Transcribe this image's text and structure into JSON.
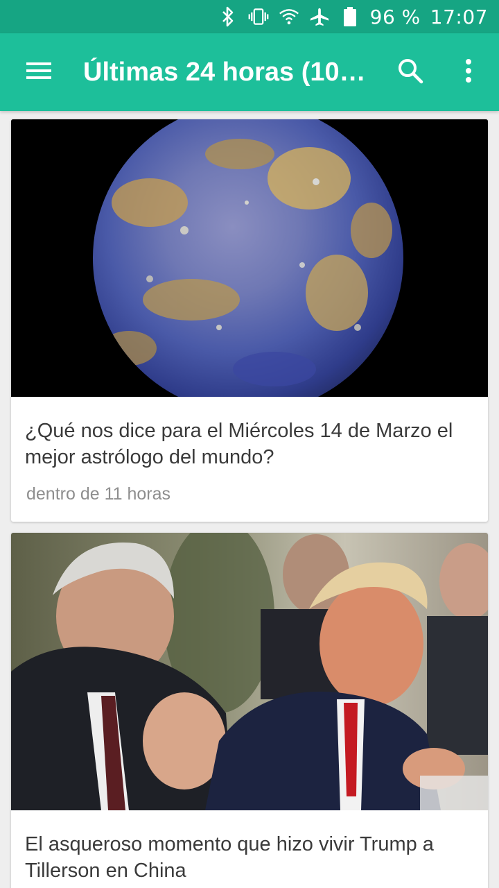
{
  "status_bar": {
    "battery": "96 %",
    "time": "17:07",
    "icons": [
      "bluetooth-icon",
      "vibrate-icon",
      "wifi-icon",
      "airplane-icon",
      "battery-icon"
    ]
  },
  "app_bar": {
    "title": "Últimas 24 horas (10…",
    "icons": [
      "menu-icon",
      "search-icon",
      "more-vert-icon"
    ]
  },
  "articles": [
    {
      "headline": "¿Qué nos dice para el Miércoles 14 de Marzo el mejor astrólogo del mundo?",
      "time": "dentro de 11 horas",
      "image": "planet-mercury-photo"
    },
    {
      "headline": "El asqueroso momento que hizo vivir Trump a Tillerson en China",
      "time": "",
      "image": "meeting-photo"
    }
  ],
  "colors": {
    "status_bar": "#16a583",
    "app_bar": "#1dbf9a",
    "background": "#eeeeee"
  }
}
